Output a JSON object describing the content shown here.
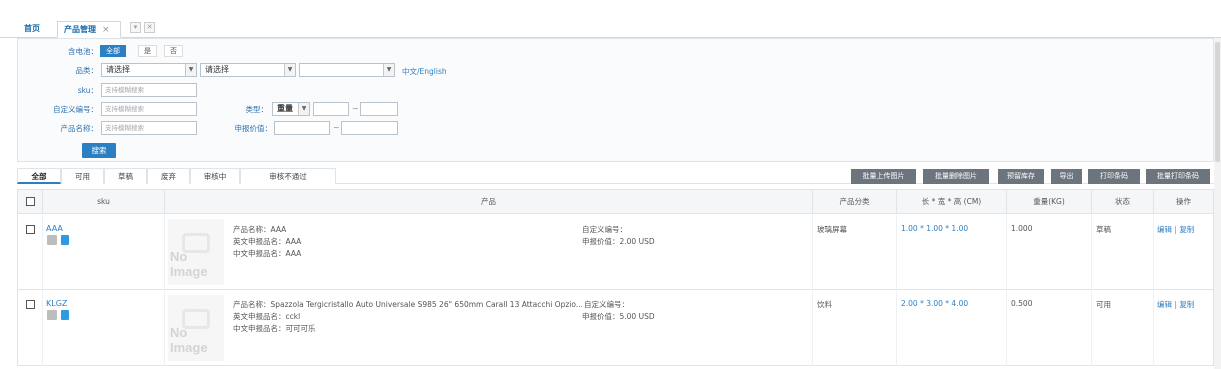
{
  "tabs": {
    "home": "首页",
    "current": "产品管理",
    "close": "×"
  },
  "filter": {
    "battery_label": "含电池：",
    "battery_options": [
      "全部",
      "是",
      "否"
    ],
    "category_label": "品类：",
    "category_select1": "请选择",
    "category_select2": "请选择",
    "category_select3": "",
    "lang_link": "中文/English",
    "sku_label": "sku：",
    "sku_placeholder": "支持模糊搜索",
    "custom_no_label": "自定义编号：",
    "custom_no_placeholder": "支持模糊搜索",
    "name_label": "产品名称：",
    "name_placeholder": "支持模糊搜索",
    "type_label": "类型：",
    "type_value": "重量",
    "tilde": "~",
    "declare_label": "申报价值：",
    "search_button": "搜索"
  },
  "status_tabs": [
    "全部",
    "可用",
    "草稿",
    "废弃",
    "审核中",
    "审核不通过"
  ],
  "actions": [
    "批量上传图片",
    "批量删除图片",
    "预留库存",
    "导出",
    "打印条码",
    "批量打印条码"
  ],
  "table": {
    "headers": [
      "sku",
      "产品",
      "产品分类",
      "长 * 宽 * 高 (CM)",
      "重量(KG)",
      "状态",
      "操作"
    ],
    "no_image": "No Image",
    "rows": [
      {
        "sku": "AAA",
        "name": "产品名称：AAA",
        "en_declare": "英文申报品名：AAA",
        "cn_declare": "中文申报品名：AAA",
        "custom_no": "自定义编号：",
        "declare_value": "申报价值：2.00 USD",
        "category": "玻璃屏幕",
        "dims": "1.00 * 1.00 * 1.00",
        "weight": "1.000",
        "status": "草稿",
        "edit": "编辑",
        "sep": "|",
        "copy": "复制"
      },
      {
        "sku": "KLGZ",
        "name": "产品名称：Spazzola Tergicristallo Auto Universale S985 26\" 650mm Carall 13 Attacchi Opzio...",
        "en_declare": "英文申报品名：cckl",
        "cn_declare": "中文申报品名：可可可乐",
        "custom_no": "自定义编号：",
        "declare_value": "申报价值：5.00 USD",
        "category": "饮料",
        "dims": "2.00 * 3.00 * 4.00",
        "weight": "0.500",
        "status": "可用",
        "edit": "编辑",
        "sep": "|",
        "copy": "复制"
      }
    ]
  }
}
